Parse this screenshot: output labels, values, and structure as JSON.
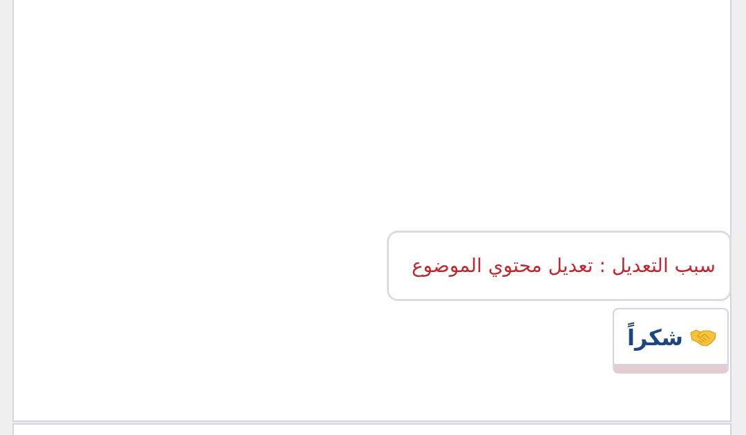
{
  "post": {
    "edit_note": {
      "text": "سبب التعديل : تعديل محتوي الموضوع"
    },
    "thanks_button": {
      "label": "شكراً"
    }
  }
}
